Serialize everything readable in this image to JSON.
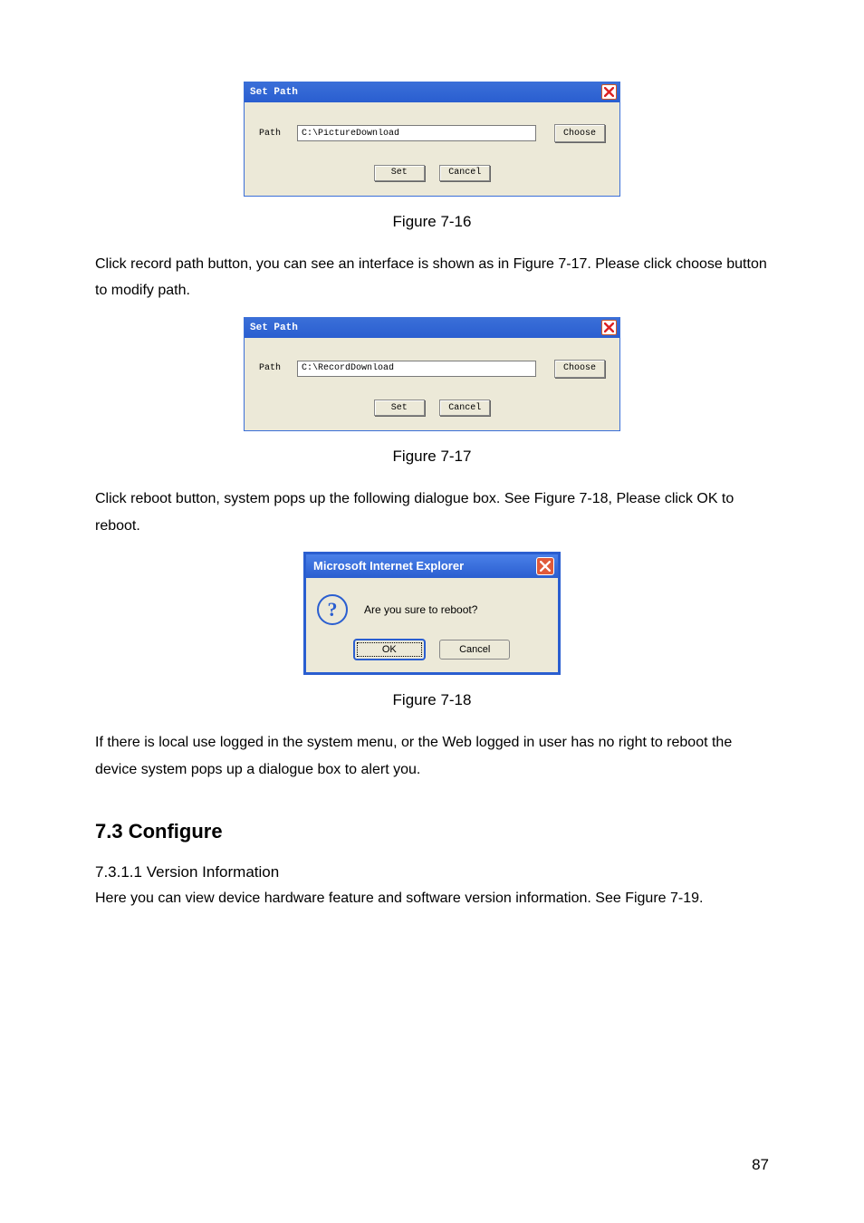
{
  "dlg1": {
    "title": "Set Path",
    "path_label": "Path",
    "path_value": "C:\\PictureDownload",
    "choose": "Choose",
    "set": "Set",
    "cancel": "Cancel"
  },
  "cap1": "Figure 7-16",
  "para1": "Click record path button, you can see an interface is shown as in Figure 7-17. Please click choose button to modify path.",
  "dlg2": {
    "title": "Set Path",
    "path_label": "Path",
    "path_value": "C:\\RecordDownload",
    "choose": "Choose",
    "set": "Set",
    "cancel": "Cancel"
  },
  "cap2": "Figure 7-17",
  "para2": "Click reboot button, system pops up the following dialogue box. See Figure 7-18, Please click OK to reboot.",
  "msgbox": {
    "title": "Microsoft Internet Explorer",
    "text": "Are you sure to reboot?",
    "ok": "OK",
    "cancel": "Cancel"
  },
  "cap3": "Figure 7-18",
  "para3": "If there is local use logged in the system menu, or the Web logged in user has no right to reboot the device system pops up a dialogue box to alert you.",
  "h2": "7.3  Configure",
  "h4": "7.3.1.1  Version Information",
  "para4": "Here you can view device hardware feature and software version information. See Figure 7-19.",
  "page_num": "87"
}
